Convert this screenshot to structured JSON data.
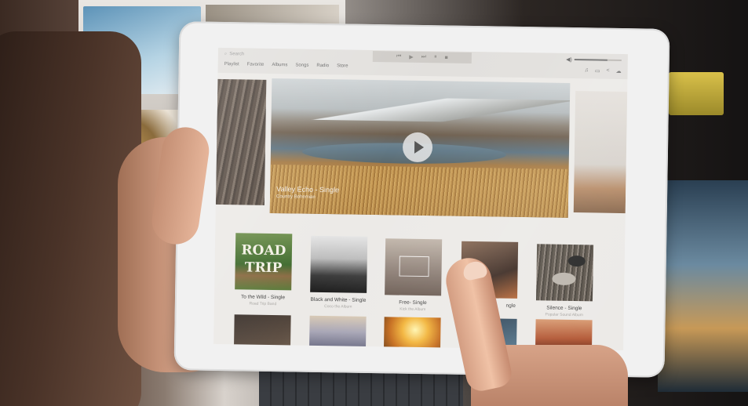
{
  "scene": {
    "description_colors": {
      "screen_bg": "#eceae7",
      "tablet_frame": "#f1f1f1",
      "accent_skin": "#e6b59a"
    }
  },
  "app": {
    "search": {
      "placeholder": "Search",
      "icon": "search-icon"
    },
    "nav": [
      "Playlist",
      "Favorite",
      "Albums",
      "Songs",
      "Radio",
      "Store"
    ],
    "player_controls": [
      {
        "name": "previous-icon",
        "glyph": "⏮"
      },
      {
        "name": "play-icon",
        "glyph": "▶"
      },
      {
        "name": "next-icon",
        "glyph": "⏭"
      },
      {
        "name": "pause-icon",
        "glyph": "⏸"
      },
      {
        "name": "stop-icon",
        "glyph": "■"
      }
    ],
    "volume": {
      "icon": "speaker-icon",
      "glyph": "🔈",
      "level": 0.7
    },
    "tools": [
      {
        "name": "music-note-icon",
        "glyph": "♫"
      },
      {
        "name": "chat-icon",
        "glyph": "▭"
      },
      {
        "name": "share-icon",
        "glyph": "<"
      },
      {
        "name": "cloud-icon",
        "glyph": "☁"
      }
    ],
    "hero": {
      "title": "Valley Echo - Single",
      "subtitle": "Country Bohemian"
    },
    "albums": [
      {
        "title": "To the Wild - Single",
        "subtitle": "Road Trip Band",
        "cover_text_1": "ROAD",
        "cover_text_2": "TRIP"
      },
      {
        "title": "Black and White - Single",
        "subtitle": "Coco the Album"
      },
      {
        "title": "Free- Single",
        "subtitle": "Kick the Album"
      },
      {
        "title": "ngle",
        "subtitle": ""
      },
      {
        "title": "Silence - Single",
        "subtitle": "Popular Sound Album"
      }
    ]
  }
}
